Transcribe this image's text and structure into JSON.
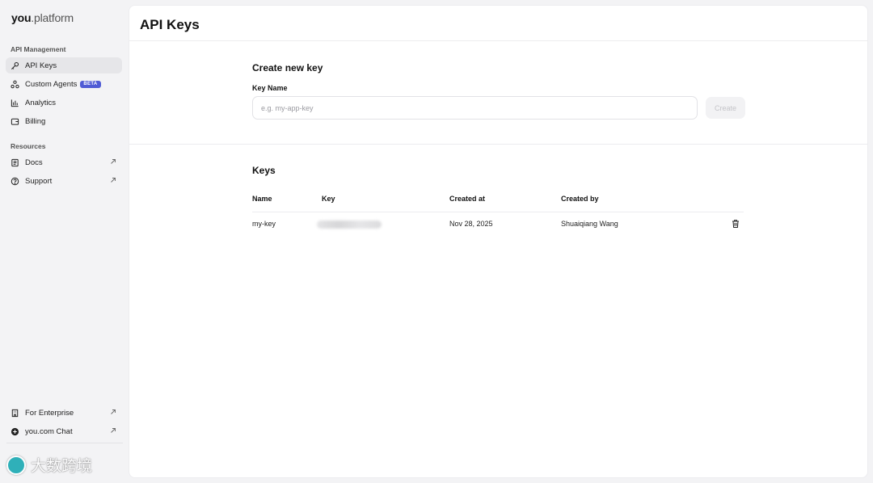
{
  "brand": {
    "name_bold": "you",
    "name_rest": ".platform"
  },
  "sidebar": {
    "section_api": "API Management",
    "api_items": [
      {
        "label": "API Keys",
        "icon": "key-icon"
      },
      {
        "label": "Custom Agents",
        "icon": "agents-icon",
        "badge": "BETA"
      },
      {
        "label": "Analytics",
        "icon": "bar-chart-icon"
      },
      {
        "label": "Billing",
        "icon": "wallet-icon"
      }
    ],
    "section_resources": "Resources",
    "resource_items": [
      {
        "label": "Docs",
        "icon": "document-icon"
      },
      {
        "label": "Support",
        "icon": "help-circle-icon"
      }
    ],
    "bottom_items": [
      {
        "label": "For Enterprise",
        "icon": "building-icon"
      },
      {
        "label": "you.com Chat",
        "icon": "plus-circle-icon"
      }
    ]
  },
  "watermark": "大数跨境",
  "main": {
    "title": "API Keys",
    "create": {
      "title": "Create new key",
      "field_label": "Key Name",
      "placeholder": "e.g. my-app-key",
      "value": "",
      "button": "Create"
    },
    "keys": {
      "title": "Keys",
      "columns": [
        "Name",
        "Key",
        "Created at",
        "Created by"
      ],
      "rows": [
        {
          "name": "my-key",
          "created_at": "Nov 28, 2025",
          "created_by": "Shuaiqiang Wang"
        }
      ]
    }
  },
  "colors": {
    "accent": "#4f5bd5",
    "sidebar_bg": "#f3f3f5",
    "active_bg": "#e6e6e9"
  }
}
